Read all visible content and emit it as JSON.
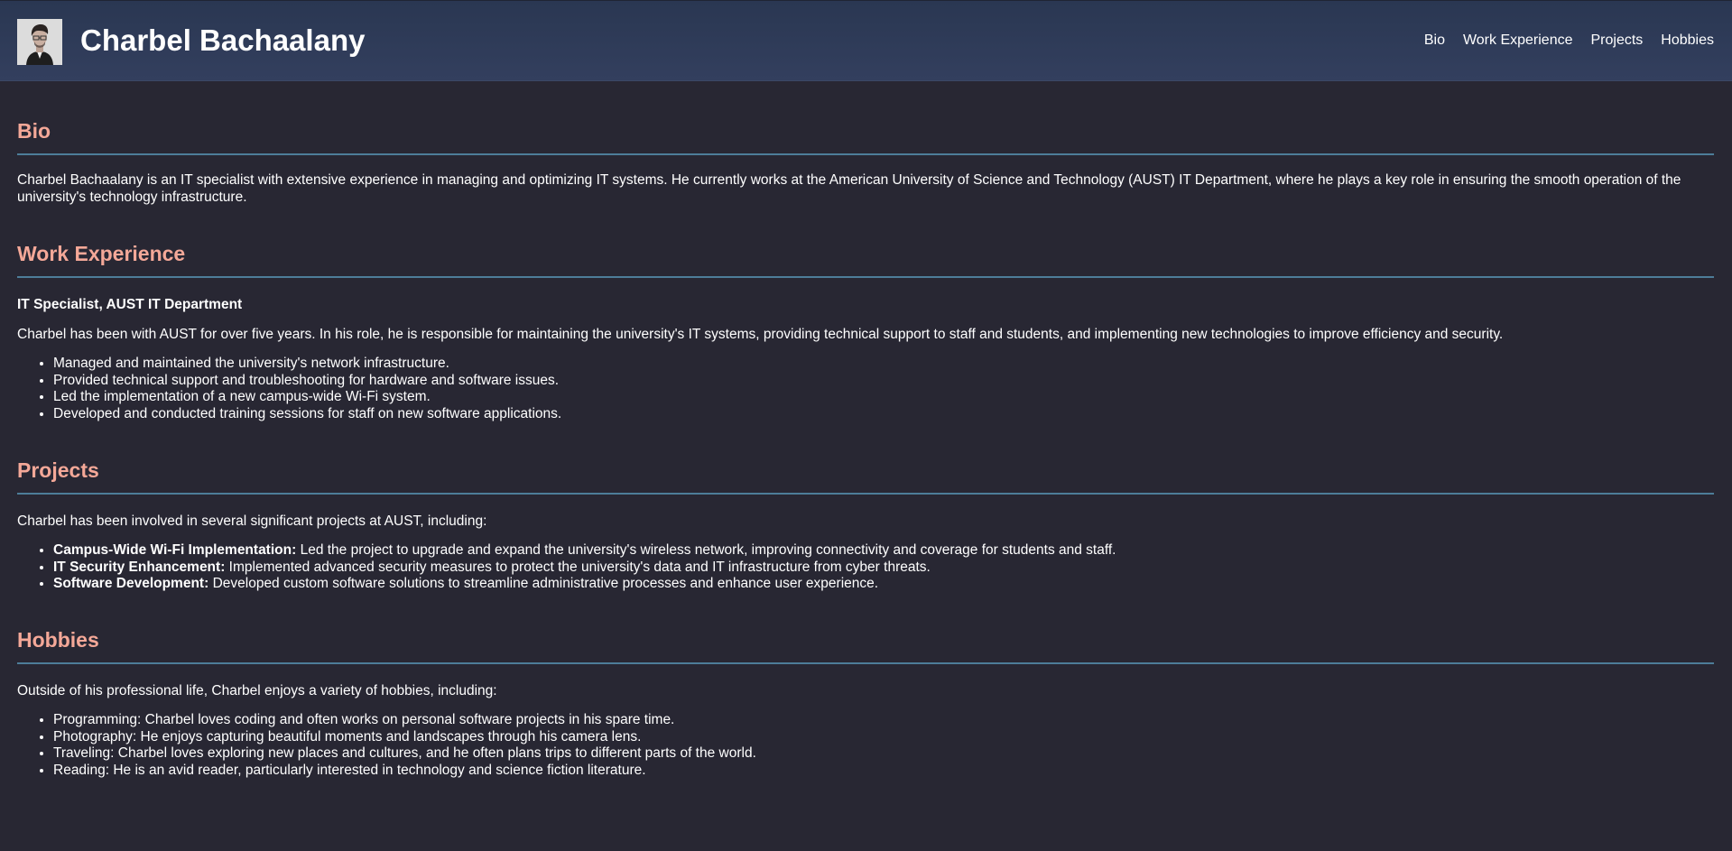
{
  "header": {
    "title": "Charbel Bachaalany",
    "nav": [
      "Bio",
      "Work Experience",
      "Projects",
      "Hobbies"
    ]
  },
  "bio": {
    "heading": "Bio",
    "text": "Charbel Bachaalany is an IT specialist with extensive experience in managing and optimizing IT systems. He currently works at the American University of Science and Technology (AUST) IT Department, where he plays a key role in ensuring the smooth operation of the university's technology infrastructure."
  },
  "work": {
    "heading": "Work Experience",
    "job_title": "IT Specialist, AUST IT Department",
    "description": "Charbel has been with AUST for over five years. In his role, he is responsible for maintaining the university's IT systems, providing technical support to staff and students, and implementing new technologies to improve efficiency and security.",
    "items": [
      "Managed and maintained the university's network infrastructure.",
      "Provided technical support and troubleshooting for hardware and software issues.",
      "Led the implementation of a new campus-wide Wi-Fi system.",
      "Developed and conducted training sessions for staff on new software applications."
    ]
  },
  "projects": {
    "heading": "Projects",
    "intro": "Charbel has been involved in several significant projects at AUST, including:",
    "items": [
      {
        "name": "Campus-Wide Wi-Fi Implementation:",
        "text": " Led the project to upgrade and expand the university's wireless network, improving connectivity and coverage for students and staff."
      },
      {
        "name": "IT Security Enhancement:",
        "text": " Implemented advanced security measures to protect the university's data and IT infrastructure from cyber threats."
      },
      {
        "name": "Software Development:",
        "text": " Developed custom software solutions to streamline administrative processes and enhance user experience."
      }
    ]
  },
  "hobbies": {
    "heading": "Hobbies",
    "intro": "Outside of his professional life, Charbel enjoys a variety of hobbies, including:",
    "items": [
      "Programming: Charbel loves coding and often works on personal software projects in his spare time.",
      "Photography: He enjoys capturing beautiful moments and landscapes through his camera lens.",
      "Traveling: Charbel loves exploring new places and cultures, and he often plans trips to different parts of the world.",
      "Reading: He is an avid reader, particularly interested in technology and science fiction literature."
    ]
  },
  "colors": {
    "header_bg": "#2e3a57",
    "page_bg": "#282733",
    "heading": "#f4a898",
    "divider": "#4d7d99",
    "text": "#ffffff"
  }
}
